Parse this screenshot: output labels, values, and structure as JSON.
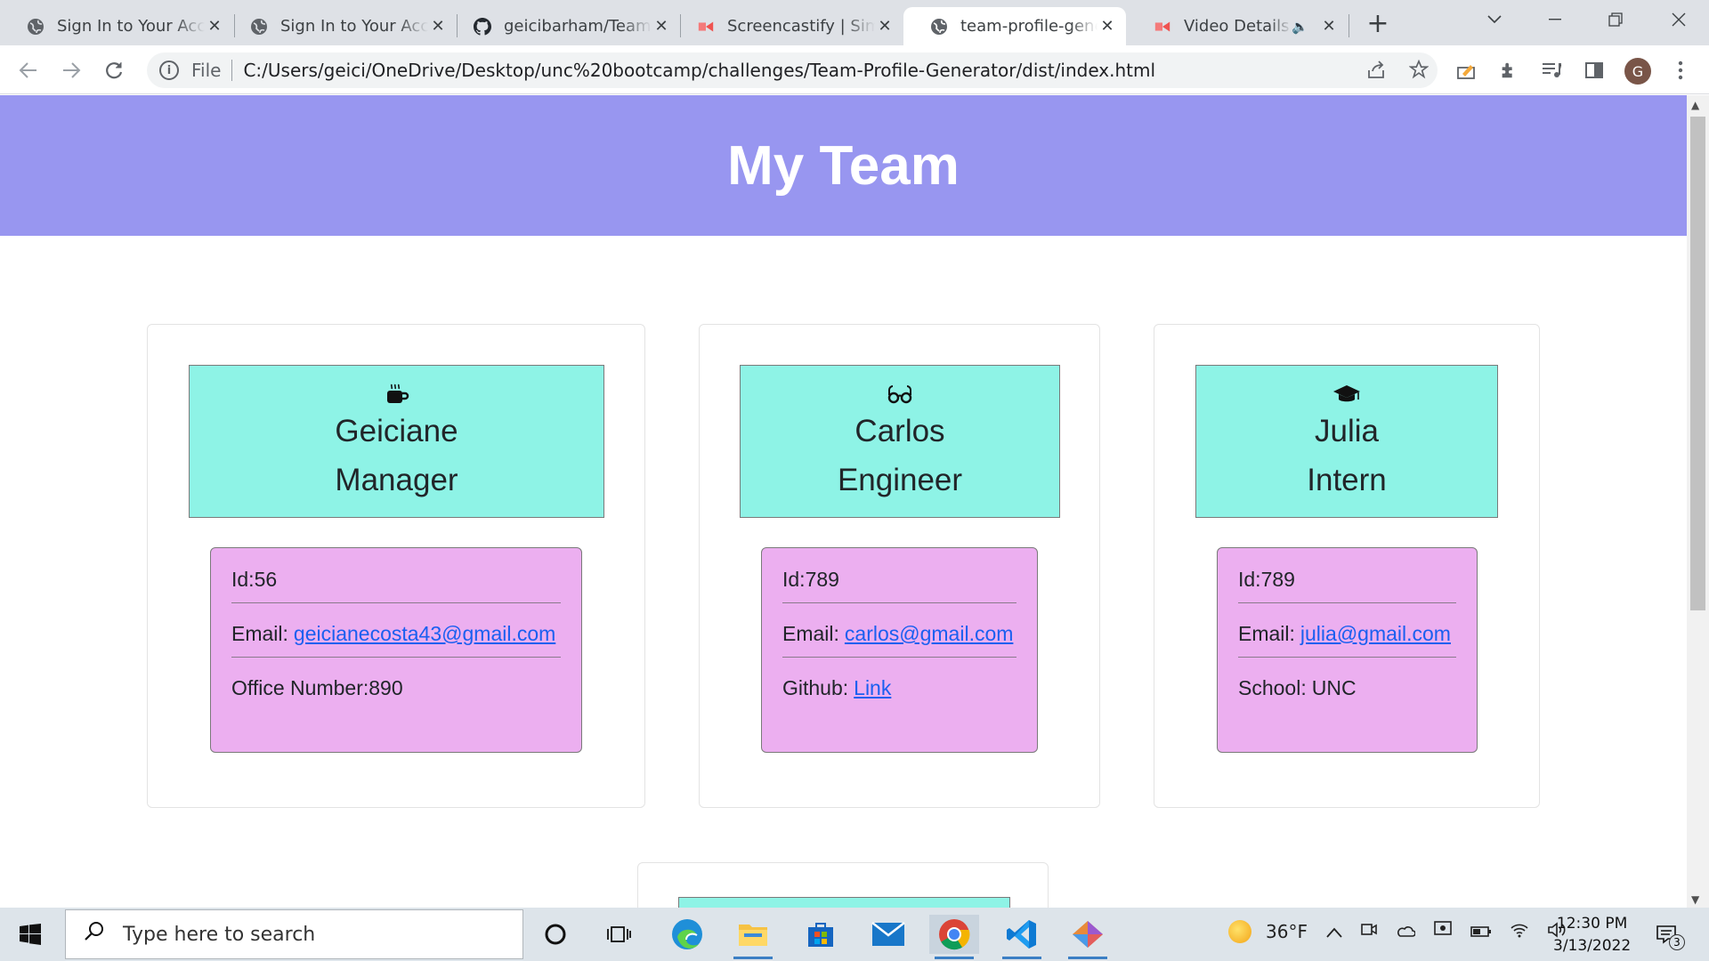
{
  "browser": {
    "tabs": [
      {
        "title": "Sign In to Your Account",
        "favicon": "globe-icon",
        "active": false
      },
      {
        "title": "Sign In to Your Account",
        "favicon": "globe-icon",
        "active": false
      },
      {
        "title": "geicibarham/Team-Profile-Generator",
        "favicon": "github-icon",
        "active": false
      },
      {
        "title": "Screencastify | Simple Screen Recorder",
        "favicon": "screencastify-icon",
        "active": false
      },
      {
        "title": "team-profile-generator",
        "favicon": "globe-icon",
        "active": true
      },
      {
        "title": "Video Details - Screencastify",
        "favicon": "screencastify-icon",
        "active": false,
        "audio": true
      }
    ],
    "address": {
      "scheme_label": "File",
      "url": "C:/Users/geici/OneDrive/Desktop/unc%20bootcamp/challenges/Team-Profile-Generator/dist/index.html"
    },
    "profile_initial": "G"
  },
  "page": {
    "heading": "My Team",
    "members": [
      {
        "icon": "mug-icon",
        "name": "Geiciane",
        "role": "Manager",
        "id_text": "Id:56",
        "email_label": "Email:",
        "email": "geicianecosta43@gmail.com",
        "extra_label": "Office Number:",
        "extra_value": "890",
        "extra_is_link": false
      },
      {
        "icon": "glasses-icon",
        "name": "Carlos",
        "role": "Engineer",
        "id_text": "Id:789",
        "email_label": "Email:",
        "email": "carlos@gmail.com",
        "extra_label": "Github:",
        "extra_value": "Link",
        "extra_is_link": true
      },
      {
        "icon": "graduation-cap-icon",
        "name": "Julia",
        "role": "Intern",
        "id_text": "Id:789",
        "email_label": "Email:",
        "email": "julia@gmail.com",
        "extra_label": "School:",
        "extra_value": "UNC",
        "extra_is_link": false
      }
    ],
    "colors": {
      "banner": "#9896f0",
      "card_header": "#8ef3e6",
      "info_box": "#ecaff0",
      "link": "#1a5ff0"
    }
  },
  "taskbar": {
    "search_placeholder": "Type here to search",
    "weather": "36°F",
    "time": "12:30 PM",
    "date": "3/13/2022",
    "notifications": "3"
  }
}
